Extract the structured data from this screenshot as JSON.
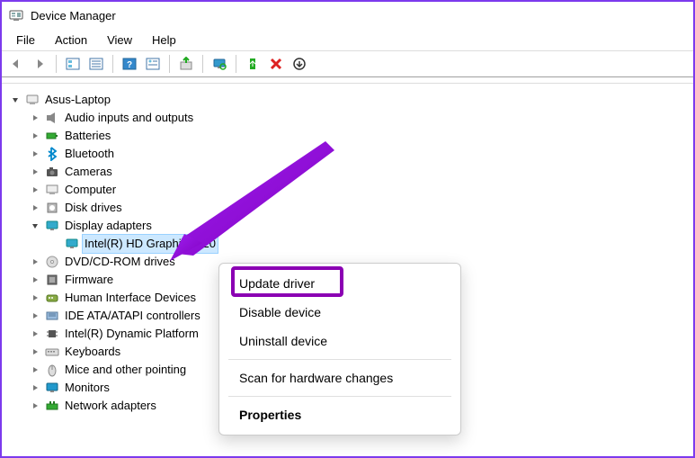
{
  "window": {
    "title": "Device Manager"
  },
  "menubar": [
    "File",
    "Action",
    "View",
    "Help"
  ],
  "tree": {
    "root": {
      "label": "Asus-Laptop",
      "expanded": true
    },
    "categories": [
      {
        "label": "Audio inputs and outputs",
        "icon": "speaker"
      },
      {
        "label": "Batteries",
        "icon": "battery"
      },
      {
        "label": "Bluetooth",
        "icon": "bluetooth"
      },
      {
        "label": "Cameras",
        "icon": "camera"
      },
      {
        "label": "Computer",
        "icon": "computer"
      },
      {
        "label": "Disk drives",
        "icon": "disk"
      },
      {
        "label": "Display adapters",
        "icon": "display",
        "expanded": true,
        "children": [
          {
            "label": "Intel(R) HD Graphics 620",
            "icon": "display",
            "selected": true
          }
        ]
      },
      {
        "label": "DVD/CD-ROM drives",
        "icon": "dvd"
      },
      {
        "label": "Firmware",
        "icon": "firmware"
      },
      {
        "label": "Human Interface Devices",
        "icon": "hid"
      },
      {
        "label": "IDE ATA/ATAPI controllers",
        "icon": "ide"
      },
      {
        "label": "Intel(R) Dynamic Platform",
        "icon": "chip"
      },
      {
        "label": "Keyboards",
        "icon": "keyboard"
      },
      {
        "label": "Mice and other pointing",
        "icon": "mouse"
      },
      {
        "label": "Monitors",
        "icon": "monitor"
      },
      {
        "label": "Network adapters",
        "icon": "network"
      }
    ]
  },
  "context_menu": {
    "items": [
      {
        "label": "Update driver",
        "highlighted": true
      },
      {
        "label": "Disable device"
      },
      {
        "label": "Uninstall device"
      },
      {
        "sep": true
      },
      {
        "label": "Scan for hardware changes"
      },
      {
        "sep": true
      },
      {
        "label": "Properties",
        "bold": true
      }
    ]
  }
}
